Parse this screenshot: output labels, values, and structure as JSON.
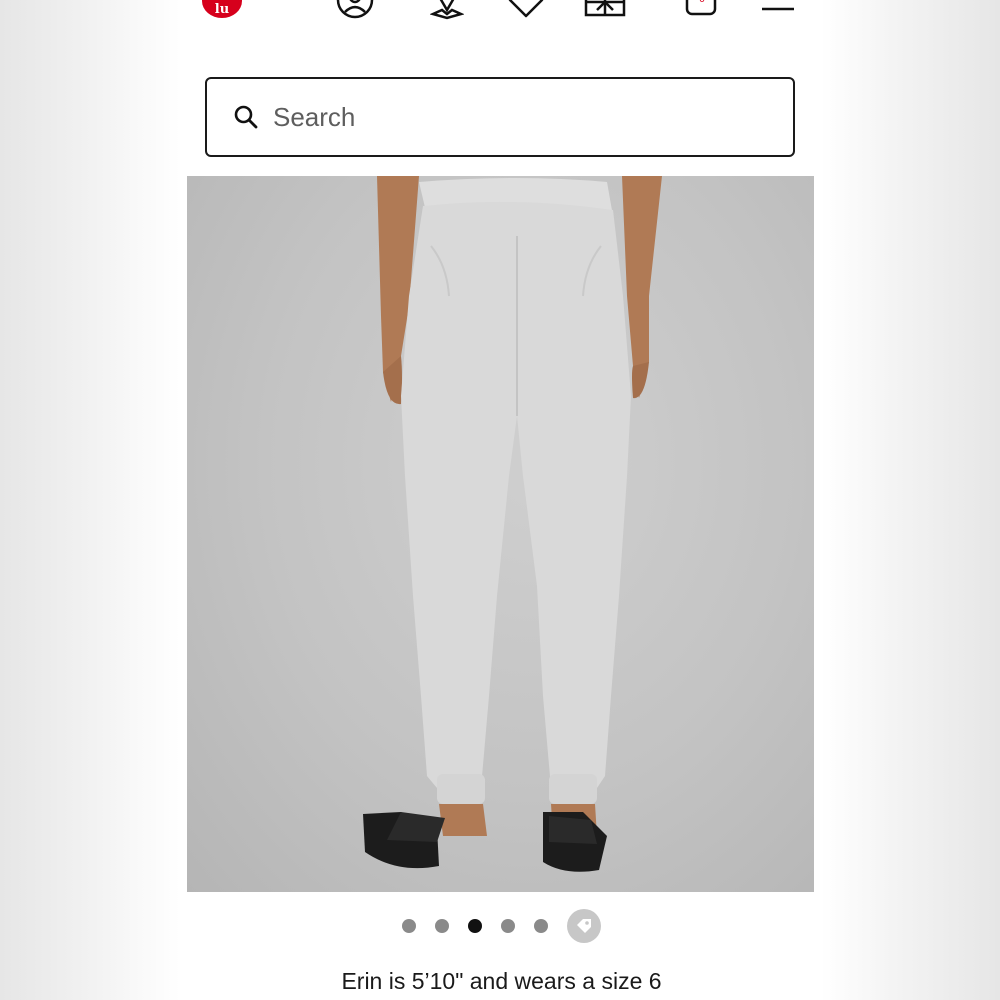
{
  "header": {
    "logo_text": "lu",
    "icons": [
      "lululemon-logo-icon",
      "account-icon",
      "store-locator-icon",
      "wishlist-heart-icon",
      "gift-card-icon",
      "shopping-bag-icon",
      "menu-icon"
    ],
    "bag_count": "0",
    "brand_color": "#d6001c"
  },
  "search": {
    "placeholder": "Search",
    "value": ""
  },
  "product": {
    "image_description_icon": "product-photo-grey-joggers",
    "carousel": {
      "total_dots": 5,
      "active_index": 3,
      "extra_icon": "tag-icon"
    },
    "model_caption": "Erin is 5’10\" and wears a size 6"
  }
}
